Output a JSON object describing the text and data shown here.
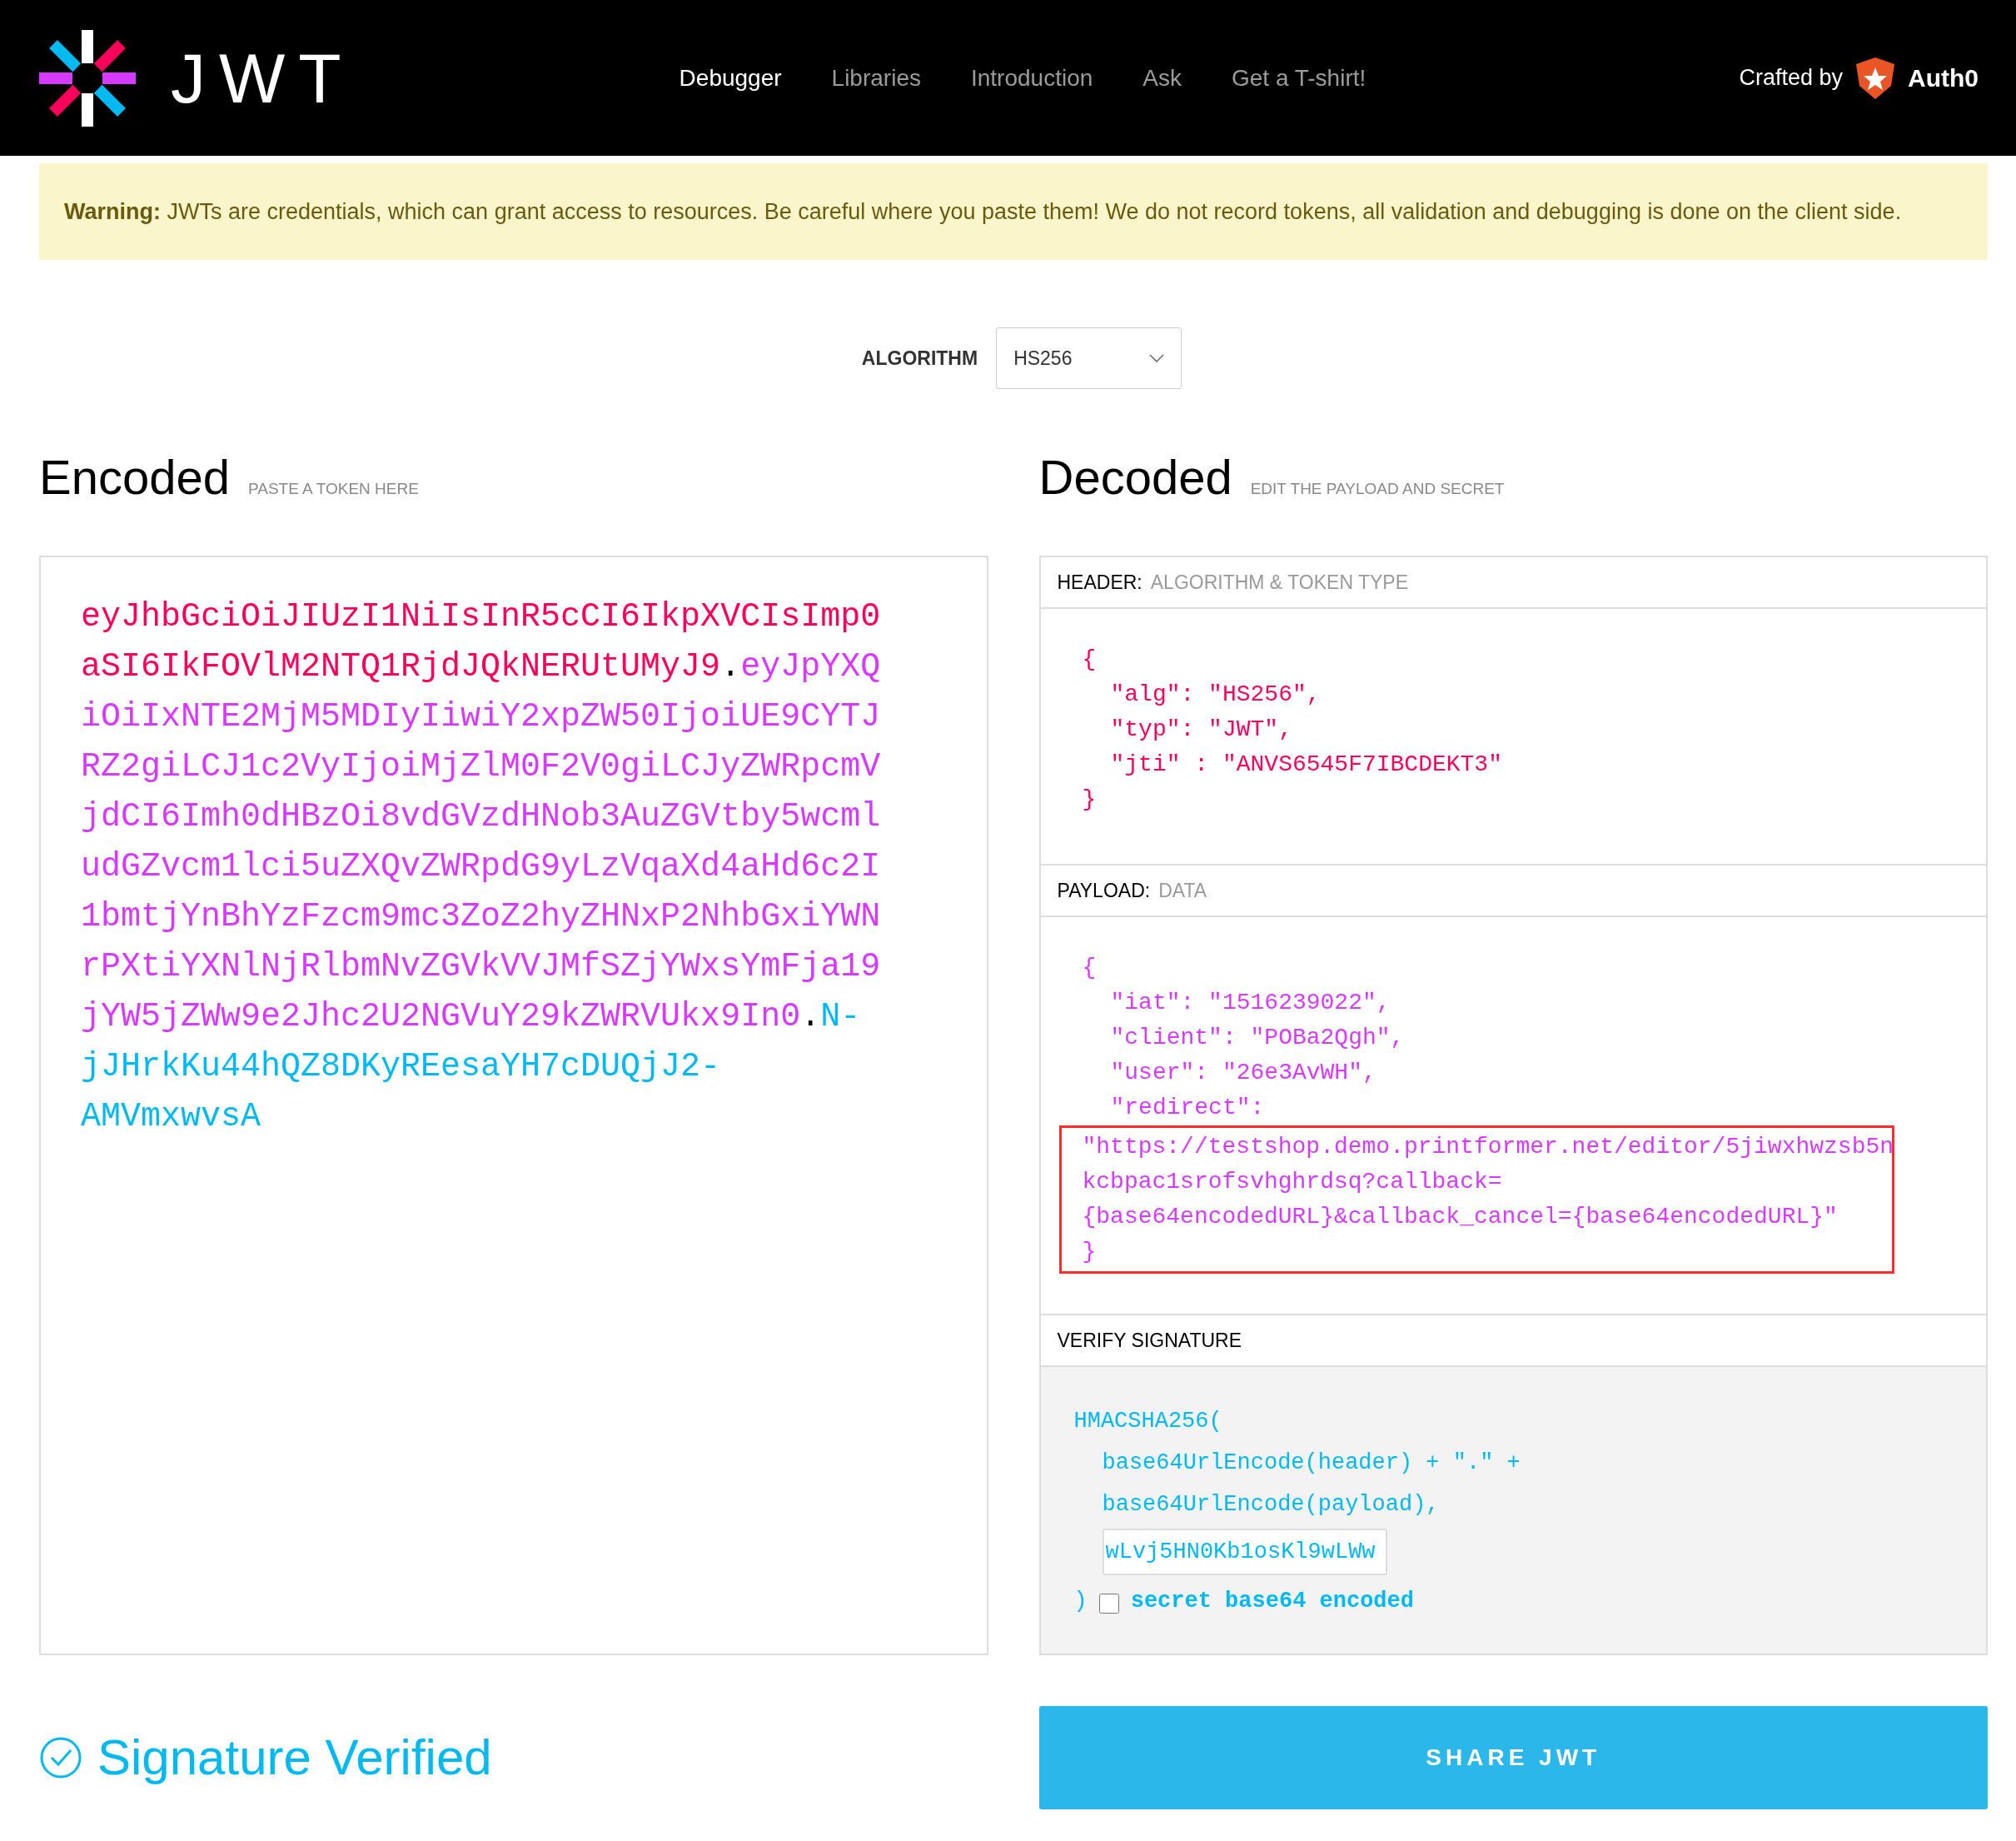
{
  "nav": {
    "logo_text": "JWT",
    "links": [
      {
        "label": "Debugger",
        "selected": true
      },
      {
        "label": "Libraries",
        "selected": false
      },
      {
        "label": "Introduction",
        "selected": false
      },
      {
        "label": "Ask",
        "selected": false
      },
      {
        "label": "Get a T-shirt!",
        "selected": false
      }
    ],
    "crafted_by": "Crafted by",
    "brand": "Auth0"
  },
  "warning": "**Warning:** JWTs are credentials, which can grant access to resources. Be careful where you paste them! We do not record tokens, all validation and debugging is done on the client side.",
  "algorithm": {
    "label": "ALGORITHM",
    "value": "HS256"
  },
  "encoded": {
    "title": "Encoded",
    "subtitle": "PASTE A TOKEN HERE",
    "lines": [
      [
        {
          "kind": "header",
          "text": "eyJhbGciOiJIUzI1NiIsInR5cCI6IkpXVCIsImp0"
        }
      ],
      [
        {
          "kind": "header",
          "text": "aSI6IkFOVlM2NTQ1RjdJQkNERUtUMyJ9"
        },
        {
          "kind": "dot",
          "text": "."
        },
        {
          "kind": "payload",
          "text": "eyJpYXQ"
        }
      ],
      [
        {
          "kind": "payload",
          "text": "iOiIxNTE2MjM5MDIyIiwiY2xpZW50IjoiUE9CYTJ"
        }
      ],
      [
        {
          "kind": "payload",
          "text": "RZ2giLCJ1c2VyIjoiMjZlM0F2V0giLCJyZWRpcmV"
        }
      ],
      [
        {
          "kind": "payload",
          "text": "jdCI6Imh0dHBzOi8vdGVzdHNob3AuZGVtby5wcml"
        }
      ],
      [
        {
          "kind": "payload",
          "text": "udGZvcm1lci5uZXQvZWRpdG9yLzVqaXd4aHd6c2I"
        }
      ],
      [
        {
          "kind": "payload",
          "text": "1bmtjYnBhYzFzcm9mc3ZoZ2hyZHNxP2NhbGxiYWN"
        }
      ],
      [
        {
          "kind": "payload",
          "text": "rPXtiYXNlNjRlbmNvZGVkVVJMfSZjYWxsYmFja19"
        }
      ],
      [
        {
          "kind": "payload",
          "text": "jYW5jZWw9e2Jhc2U2NGVuY29kZWRVUkx9In0"
        },
        {
          "kind": "dot",
          "text": "."
        },
        {
          "kind": "signature",
          "text": "N-"
        }
      ],
      [
        {
          "kind": "signature",
          "text": "jJHrkKu44hQZ8DKyREesaYH7cDUQjJ2-"
        }
      ],
      [
        {
          "kind": "signature",
          "text": "AMVmxwvsA"
        }
      ]
    ]
  },
  "decoded": {
    "title": "Decoded",
    "subtitle": "EDIT THE PAYLOAD AND SECRET",
    "header_section": {
      "label": "HEADER:",
      "sublabel": "ALGORITHM & TOKEN TYPE",
      "open": "{",
      "entries": [
        "\"alg\": \"HS256\",",
        "\"typ\": \"JWT\",",
        "\"jti\" : \"ANVS6545F7IBCDEKT3\""
      ],
      "close": "}"
    },
    "payload_section": {
      "label": "PAYLOAD:",
      "sublabel": "DATA",
      "open": "{",
      "entries": [
        "\"iat\": \"1516239022\",",
        "\"client\": \"POBa2Qgh\",",
        "\"user\": \"26e3AvWH\",",
        "\"redirect\":"
      ],
      "boxed_lines": [
        "\"https://testshop.demo.printformer.net/editor/5jiwxhwzsb5n",
        "kcbpac1srofsvhghrdsq?callback=",
        "{base64encodedURL}&callback_cancel={base64encodedURL}\"",
        "}"
      ]
    },
    "verify_section": {
      "label": "VERIFY SIGNATURE",
      "lines": [
        "HMACSHA256(",
        "base64UrlEncode(header) + \".\" +",
        "base64UrlEncode(payload),"
      ],
      "secret": "wLvj5HN0Kb1osKl9wLWw",
      "close": ")",
      "base64_label": "secret base64 encoded",
      "base64_checked": false
    }
  },
  "status": {
    "text": "Signature Verified",
    "verified": true
  },
  "share_button": "SHARE JWT"
}
